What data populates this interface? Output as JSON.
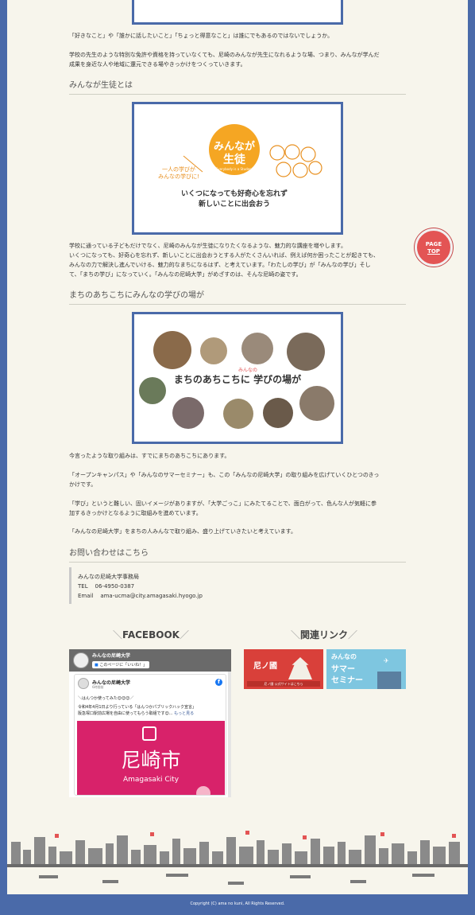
{
  "intro": {
    "p1": "「好きなこと」や「誰かに話したいこと」「ちょっと得意なこと」は誰にでもあるのではないでしょうか。",
    "p2a": "学校の先生のような特別な免許や資格を持っていなくても、尼崎のみんなが先生になれるような場、つまり、みんなが学んだ",
    "p2b": "成果を身近な人や地域に還元できる場やきっかけをつくっていきます。"
  },
  "section_students": {
    "heading": "みんなが生徒とは",
    "figure": {
      "badge_line1": "みんなが",
      "badge_line2": "生徒",
      "badge_sub": "Everybody is a Student",
      "side_text1": "一人の学びが",
      "side_text2": "みんなの学びに!",
      "caption1": "いくつになっても好奇心を忘れず",
      "caption2": "新しいことに出会おう"
    },
    "p1": "学校に通っている子どもだけでなく、尼崎のみんなが生徒になりたくなるような、魅力的な講座を増やします。",
    "p2": "いくつになっても、好奇心を忘れず、新しいことに出会おうとする人がたくさんいれば、例えば何か困ったことが起きても、",
    "p3": "みんなの力で解決し進んでいける、魅力的なまちになるはず、と考えています。「わたしの学び」が「みんなの学び」そし",
    "p4": "て、「まちの学び」になっていく。「みんなの尼崎大学」がめざすのは、そんな尼崎の姿です。"
  },
  "section_town": {
    "heading": "まちのあちこちにみんなの学びの場が",
    "figure": {
      "title_small": "みんなの",
      "title": "まちのあちこちに 学びの場が"
    },
    "p1": "今言ったような取り組みは、すでにまちのあちこちにあります。",
    "p2a": "「オープンキャンパス」や「みんなのサマーセミナー」も、この「みんなの尼崎大学」の取り組みを広げていくひとつのきっ",
    "p2b": "かけです。",
    "p3a": "「学び」というと難しい、固いイメージがありますが、「大学ごっこ」にみたてることで、面白がって、色んな人が気軽に参",
    "p3b": "加するきっかけとなるように取組みを進めています。",
    "p4": "「みんなの尼崎大学」をまちの人みんなで取り組み、盛り上げていきたいと考えています。"
  },
  "contact": {
    "heading": "お問い合わせはこちら",
    "org": "みんなの尼崎大学事務局",
    "tel_label": "TEL",
    "tel": "06-4950-0387",
    "email_label": "Email",
    "email": "ama-ucma@city.amagasaki.hyogo.jp"
  },
  "facebook": {
    "title": "FACEBOOK",
    "page_name": "みんなの尼崎大学",
    "like_label": "このページに「いいね！」",
    "post_author": "みんなの尼崎大学",
    "post_time": "6時間前",
    "post_line1": "＼はんつか使ってみた😊😊😊／",
    "post_line2": "令和4年4月1日より行っている「はんつかパブリックハック宣言」",
    "post_line3": "阪急塚口駅前広場を自由に使ってもらう取組です😊...",
    "more_label": "もっと見る",
    "city_name": "尼崎市",
    "city_en": "Amagasaki City"
  },
  "links": {
    "title": "関連リンク",
    "banner1": "尼ノ國",
    "banner1_sub": "尼ノ國 公式サイトはこちら",
    "banner2_l1": "みんなの",
    "banner2_l2": "サマー",
    "banner2_l3": "セミナー"
  },
  "page_top": {
    "l1": "PAGE",
    "l2": "TOP"
  },
  "footer": {
    "copyright": "Copyright (C) ama no kuni, All Rights Reserved."
  },
  "colors": {
    "frame": "#4a6aa9",
    "accent_red": "#e35454",
    "badge_orange": "#f5a623",
    "city_pink": "#d8226a"
  }
}
